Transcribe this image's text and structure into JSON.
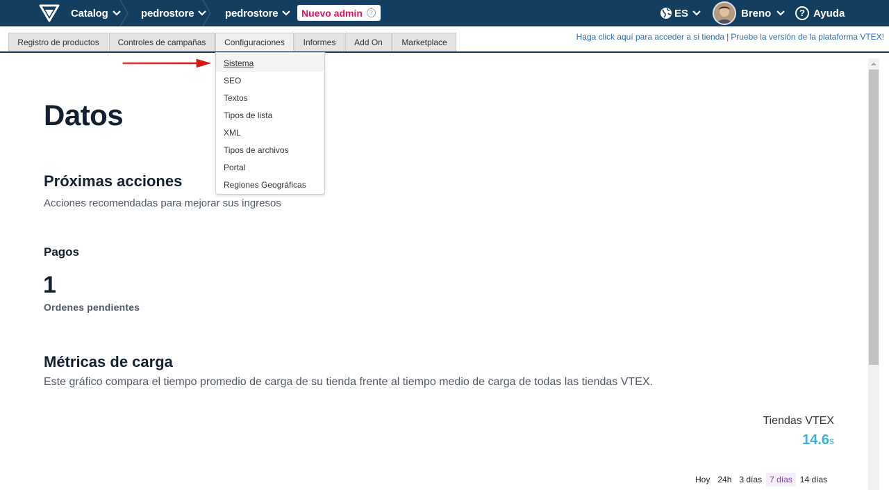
{
  "topbar": {
    "breadcrumbs": [
      "Catalog",
      "pedrostore",
      "pedrostore"
    ],
    "nuevo_admin": "Nuevo admin",
    "language": "ES",
    "user": "Breno",
    "help": "Ayuda"
  },
  "tabs": [
    {
      "label": "Registro de productos"
    },
    {
      "label": "Controles de campañas"
    },
    {
      "label": "Configuraciones"
    },
    {
      "label": "Informes"
    },
    {
      "label": "Add On"
    },
    {
      "label": "Marketplace"
    }
  ],
  "store_links": {
    "access_store": "Haga click aquí para acceder a si tienda",
    "separator": "|",
    "try_version": "Pruebe la versión de la plataforma VTEX!"
  },
  "dropdown": {
    "items": [
      "Sistema",
      "SEO",
      "Textos",
      "Tipos de lista",
      "XML",
      "Tipos de archivos",
      "Portal",
      "Regiones Geográficas"
    ],
    "hovered": "Sistema"
  },
  "main": {
    "title": "Datos",
    "next_actions": {
      "heading": "Próximas acciones",
      "subtitle": "Acciones recomendadas para mejorar sus ingresos"
    },
    "payments": {
      "heading": "Pagos",
      "count": "1",
      "label": "Ordenes pendientes"
    },
    "load_metrics": {
      "heading": "Métricas de carga",
      "description": "Este gráfico compara el tiempo promedio de carga de su tienda frente al tiempo medio de carga de todas las tiendas VTEX.",
      "vtex_label": "Tiendas VTEX",
      "vtex_value": "14.6",
      "vtex_unit": "s",
      "ranges": [
        "Hoy",
        "24h",
        "3 días",
        "7 días",
        "14 días"
      ],
      "active_range": "7 días"
    }
  },
  "colors": {
    "topbar": "#143e60",
    "nuevo_admin": "#e0135f",
    "link": "#2a6db5",
    "metric": "#3bb0d6",
    "active_range": "#7f40c8",
    "arrow": "#e31b1b"
  }
}
